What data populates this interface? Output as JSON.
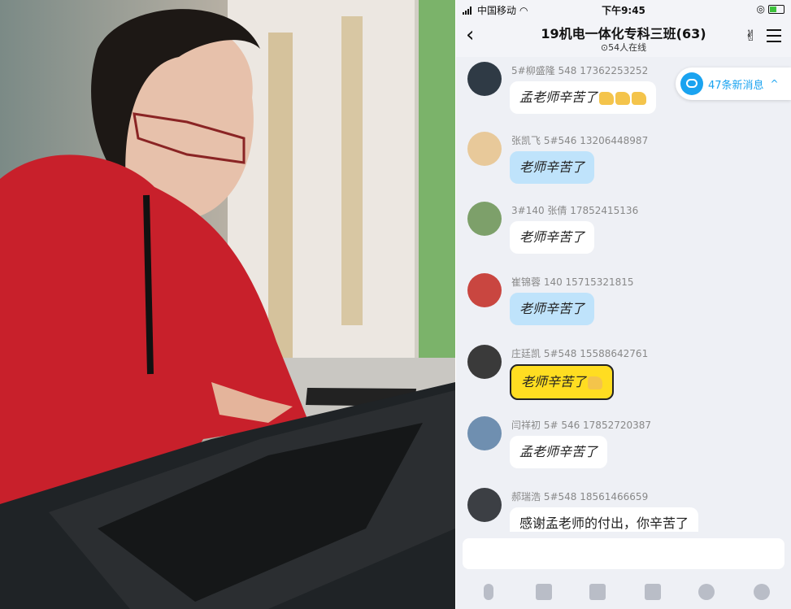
{
  "status_bar": {
    "carrier": "中国移动",
    "time": "下午9:45"
  },
  "chat": {
    "title": "19机电一体化专科三班(63)",
    "online": "⊙54人在线",
    "new_messages": "47条新消息"
  },
  "messages": [
    {
      "sender": "5#柳盛隆 548 17362253252",
      "text": "孟老师辛苦了",
      "style": "white",
      "emojis": 3
    },
    {
      "sender": "张凯飞  5#546    13206448987",
      "text": "老师辛苦了",
      "style": "blue",
      "emojis": 0
    },
    {
      "sender": "3#140 张倩 17852415136",
      "text": "老师辛苦了",
      "style": "white",
      "emojis": 0
    },
    {
      "sender": "崔锦蓉 140 15715321815",
      "text": "老师辛苦了",
      "style": "blue",
      "emojis": 0
    },
    {
      "sender": "庄廷凯  5#548  15588642761",
      "text": "老师辛苦了",
      "style": "yellow",
      "emojis": 1
    },
    {
      "sender": "闫祥初 5# 546 17852720387",
      "text": "孟老师辛苦了",
      "style": "white",
      "emojis": 0
    },
    {
      "sender": "郝瑞浩 5#548 18561466659",
      "text": "感谢孟老师的付出，你辛苦了",
      "style": "white",
      "emojis": 0
    }
  ],
  "icons": [
    "back-icon",
    "hand-icon",
    "menu-icon",
    "message-icon",
    "chevron-up-icon",
    "microphone-icon",
    "image-icon",
    "camera-icon",
    "red-packet-icon",
    "emoji-icon",
    "plus-icon"
  ]
}
